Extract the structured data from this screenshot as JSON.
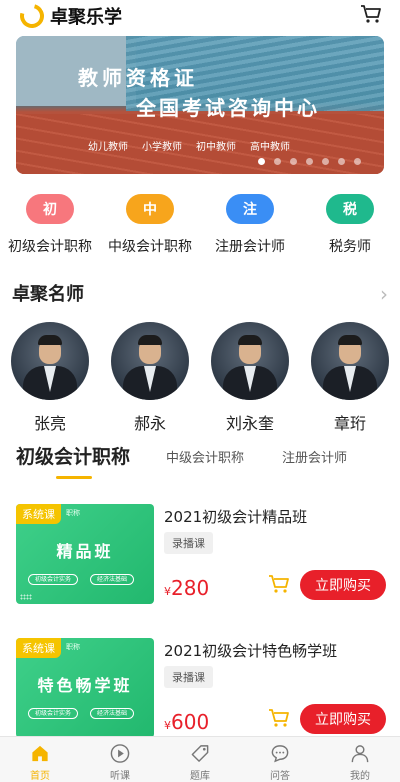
{
  "app": {
    "title": "卓聚乐学"
  },
  "banner": {
    "title1": "教师资格证",
    "title2": "全国考试咨询中心",
    "tags": [
      "幼儿教师",
      "小学教师",
      "初中教师",
      "高中教师"
    ]
  },
  "categories": [
    {
      "icon_text": "初",
      "label": "初级会计职称",
      "color": "#f7777d"
    },
    {
      "icon_text": "中",
      "label": "中级会计职称",
      "color": "#f7a51c"
    },
    {
      "icon_text": "注",
      "label": "注册会计师",
      "color": "#3a8ef5"
    },
    {
      "icon_text": "税",
      "label": "税务师",
      "color": "#1fb98d"
    }
  ],
  "teachers_section": {
    "title": "卓聚名师"
  },
  "teachers": [
    {
      "name": "张亮"
    },
    {
      "name": "郝永"
    },
    {
      "name": "刘永奎"
    },
    {
      "name": "章珩"
    }
  ],
  "tabs": [
    "初级会计职称",
    "中级会计职称",
    "注册会计师"
  ],
  "courses": [
    {
      "badge": "系统课",
      "sub": "职称",
      "thumb_title": "精品班",
      "pills": [
        "初级会计实务",
        "经济法基础"
      ],
      "title": "2021初级会计精品班",
      "tag": "录播课",
      "currency": "¥",
      "price": "280",
      "buy_label": "立即购买"
    },
    {
      "badge": "系统课",
      "sub": "职称",
      "thumb_title": "特色畅学班",
      "pills": [
        "初级会计实务",
        "经济法基础"
      ],
      "title": "2021初级会计特色畅学班",
      "tag": "录播课",
      "currency": "¥",
      "price": "600",
      "buy_label": "立即购买"
    }
  ],
  "nav": [
    {
      "label": "首页",
      "icon": "home-icon",
      "active": true
    },
    {
      "label": "听课",
      "icon": "play-icon",
      "active": false
    },
    {
      "label": "题库",
      "icon": "tag-icon",
      "active": false
    },
    {
      "label": "问答",
      "icon": "chat-icon",
      "active": false
    },
    {
      "label": "我的",
      "icon": "user-icon",
      "active": false
    }
  ],
  "colors": {
    "accent": "#f5b400",
    "price": "#e8202a",
    "thumb_green": "#2ec27e"
  }
}
